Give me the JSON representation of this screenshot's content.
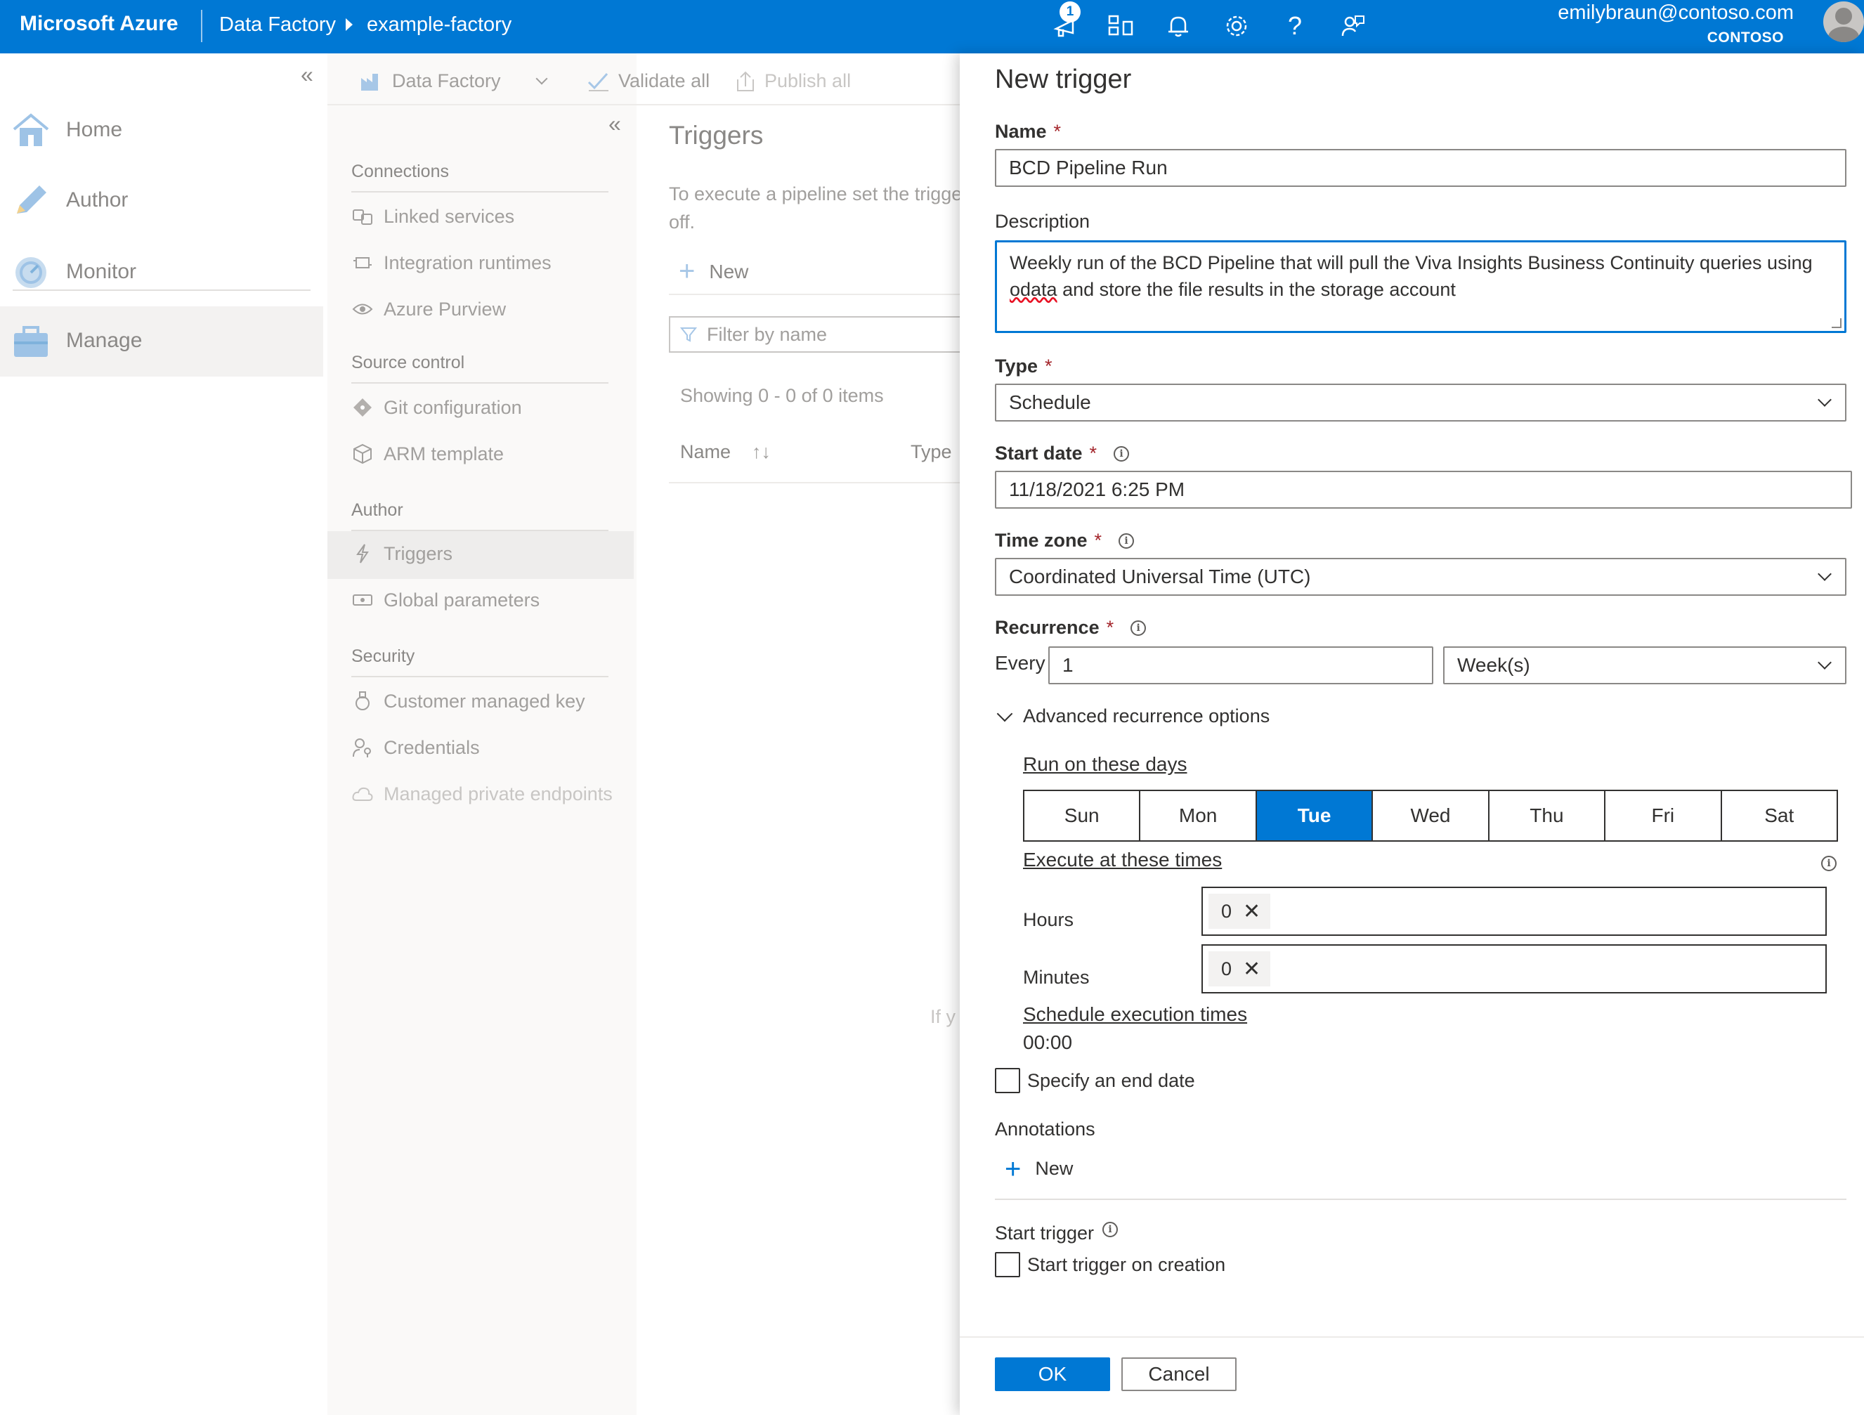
{
  "topbar": {
    "brand": "Microsoft Azure",
    "breadcrumb": [
      "Data Factory",
      "example-factory"
    ],
    "notifications_count": "1",
    "user_email": "emilybraun@contoso.com",
    "user_org": "CONTOSO",
    "icons": [
      "notification-icon",
      "directory-icon",
      "bell-icon",
      "gear-icon",
      "help-icon",
      "feedback-icon"
    ]
  },
  "leftnav": {
    "items": [
      {
        "label": "Home",
        "icon": "home-icon"
      },
      {
        "label": "Author",
        "icon": "pencil-icon"
      },
      {
        "label": "Monitor",
        "icon": "monitor-icon"
      },
      {
        "label": "Manage",
        "icon": "toolbox-icon"
      }
    ],
    "active": "Manage"
  },
  "toolbar": {
    "factory_label": "Data Factory",
    "validate_label": "Validate all",
    "publish_label": "Publish all"
  },
  "manage_nav": {
    "sections": [
      {
        "title": "Connections",
        "items": [
          "Linked services",
          "Integration runtimes",
          "Azure Purview"
        ]
      },
      {
        "title": "Source control",
        "items": [
          "Git configuration",
          "ARM template"
        ]
      },
      {
        "title": "Author",
        "items": [
          "Triggers",
          "Global parameters"
        ]
      },
      {
        "title": "Security",
        "items": [
          "Customer managed key",
          "Credentials",
          "Managed private endpoints"
        ]
      }
    ],
    "selected": "Triggers"
  },
  "triggers_pane": {
    "title": "Triggers",
    "description_line1": "To execute a pipeline set the trigge",
    "description_line2": "off.",
    "new_label": "New",
    "filter_placeholder": "Filter by name",
    "showing": "Showing 0 - 0 of 0 items",
    "col_name": "Name",
    "col_type": "Type",
    "empty_hint_fragment": "If y"
  },
  "dialog": {
    "title": "New trigger",
    "name_label": "Name",
    "name_value": "BCD Pipeline Run",
    "description_label": "Description",
    "description_value_part1": "Weekly run of the BCD Pipeline that will pull the Viva Insights Business Continuity queries using",
    "description_value_misspelled": "odata",
    "description_value_part2": "and store the file results in the storage account",
    "type_label": "Type",
    "type_value": "Schedule",
    "start_date_label": "Start date",
    "start_date_value": "11/18/2021 6:25 PM",
    "time_zone_label": "Time zone",
    "time_zone_value": "Coordinated Universal Time (UTC)",
    "recurrence_label": "Recurrence",
    "every_label": "Every",
    "every_value": "1",
    "unit_value": "Week(s)",
    "advanced_label": "Advanced recurrence options",
    "run_days_label": "Run on these days",
    "days": [
      "Sun",
      "Mon",
      "Tue",
      "Wed",
      "Thu",
      "Fri",
      "Sat"
    ],
    "selected_days": [
      "Tue"
    ],
    "execute_times_label": "Execute at these times",
    "hours_label": "Hours",
    "hours_value": "0",
    "minutes_label": "Minutes",
    "minutes_value": "0",
    "schedule_times_label": "Schedule execution times",
    "schedule_times_value": "00:00",
    "end_date_label": "Specify an end date",
    "end_date_checked": false,
    "annotations_label": "Annotations",
    "annotations_new": "New",
    "start_trigger_label": "Start trigger",
    "start_on_creation_label": "Start trigger on creation",
    "start_on_creation_checked": false,
    "ok_label": "OK",
    "cancel_label": "Cancel",
    "required_marker": "*"
  },
  "colors": {
    "accent": "#0078d4",
    "required": "#a4262c",
    "muted_text": "#a19f9d"
  }
}
